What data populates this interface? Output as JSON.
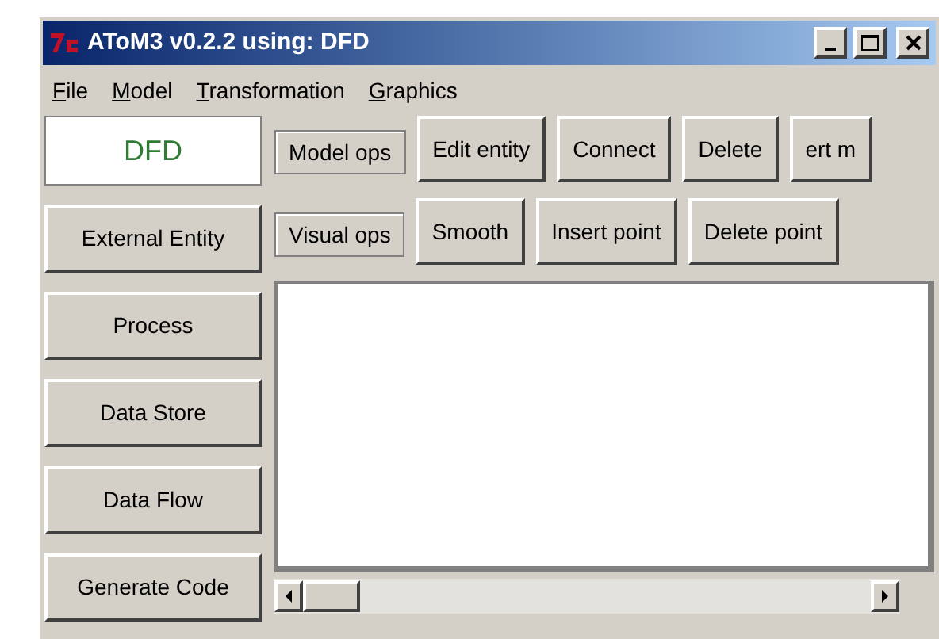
{
  "window": {
    "title": "AToM3 v0.2.2 using: DFD"
  },
  "menu": [
    {
      "label": "File"
    },
    {
      "label": "Model"
    },
    {
      "label": "Transformation"
    },
    {
      "label": "Graphics"
    }
  ],
  "model_name": "DFD",
  "toolbar_rows": [
    [
      {
        "label": "Model ops",
        "kind": "flat"
      },
      {
        "label": "Edit entity",
        "kind": "raised"
      },
      {
        "label": "Connect",
        "kind": "raised"
      },
      {
        "label": "Delete",
        "kind": "raised"
      },
      {
        "label": "ert m",
        "kind": "raised"
      }
    ],
    [
      {
        "label": "Visual ops",
        "kind": "flat"
      },
      {
        "label": "Smooth",
        "kind": "raised"
      },
      {
        "label": "Insert point",
        "kind": "raised"
      },
      {
        "label": "Delete point",
        "kind": "raised"
      }
    ]
  ],
  "entity_buttons": [
    "External Entity",
    "Process",
    "Data Store",
    "Data Flow",
    "Generate Code"
  ]
}
